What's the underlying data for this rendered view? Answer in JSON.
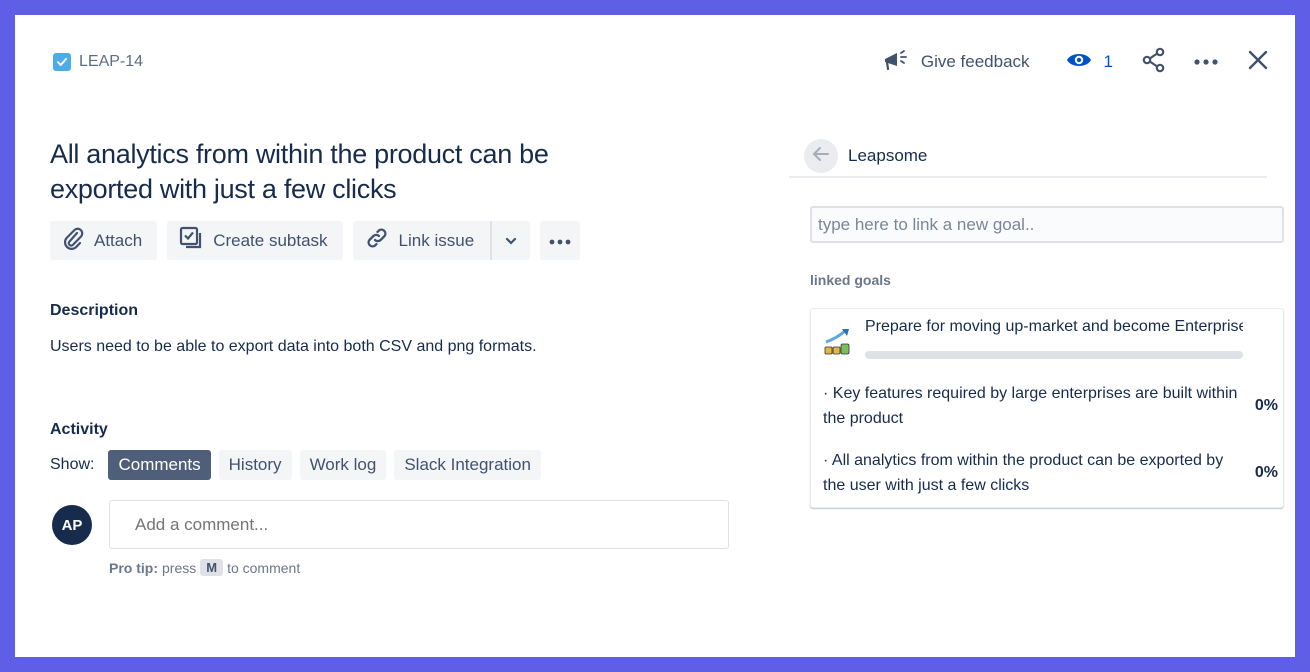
{
  "issue": {
    "key": "LEAP-14",
    "type_icon": "task-checkbox-icon",
    "title": "All analytics from within the product can be exported with just a few clicks"
  },
  "header_actions": {
    "feedback_label": "Give feedback",
    "watchers_count": "1"
  },
  "toolbar": {
    "attach_label": "Attach",
    "create_subtask_label": "Create subtask",
    "link_issue_label": "Link issue"
  },
  "description": {
    "label": "Description",
    "text": "Users need to be able to export data into both CSV and png formats."
  },
  "activity": {
    "label": "Activity",
    "show_label": "Show:",
    "filters": [
      {
        "label": "Comments",
        "active": true
      },
      {
        "label": "History",
        "active": false
      },
      {
        "label": "Work log",
        "active": false
      },
      {
        "label": "Slack Integration",
        "active": false
      }
    ],
    "avatar_initials": "AP",
    "comment_placeholder": "Add a comment...",
    "pro_tip_bold": "Pro tip:",
    "pro_tip_press": "press",
    "pro_tip_key": "M",
    "pro_tip_suffix": "to comment"
  },
  "right_panel": {
    "title": "Leapsome",
    "goal_input_placeholder": "type here to link a new goal..",
    "linked_goals_label": "linked goals",
    "goal": {
      "title": "Prepare for moving up-market and become Enterprise-ready",
      "progress": 0,
      "key_results": [
        {
          "text": "· Key features required by large enterprises are built within the product",
          "percent": "0%"
        },
        {
          "text": "· All analytics from within the product can be exported by the user with just a few clicks",
          "percent": "0%"
        }
      ]
    }
  },
  "colors": {
    "frame_border": "#5e5ee6",
    "active_chip": "#505f79",
    "watch_blue": "#0052cc",
    "task_icon": "#4bade8"
  }
}
